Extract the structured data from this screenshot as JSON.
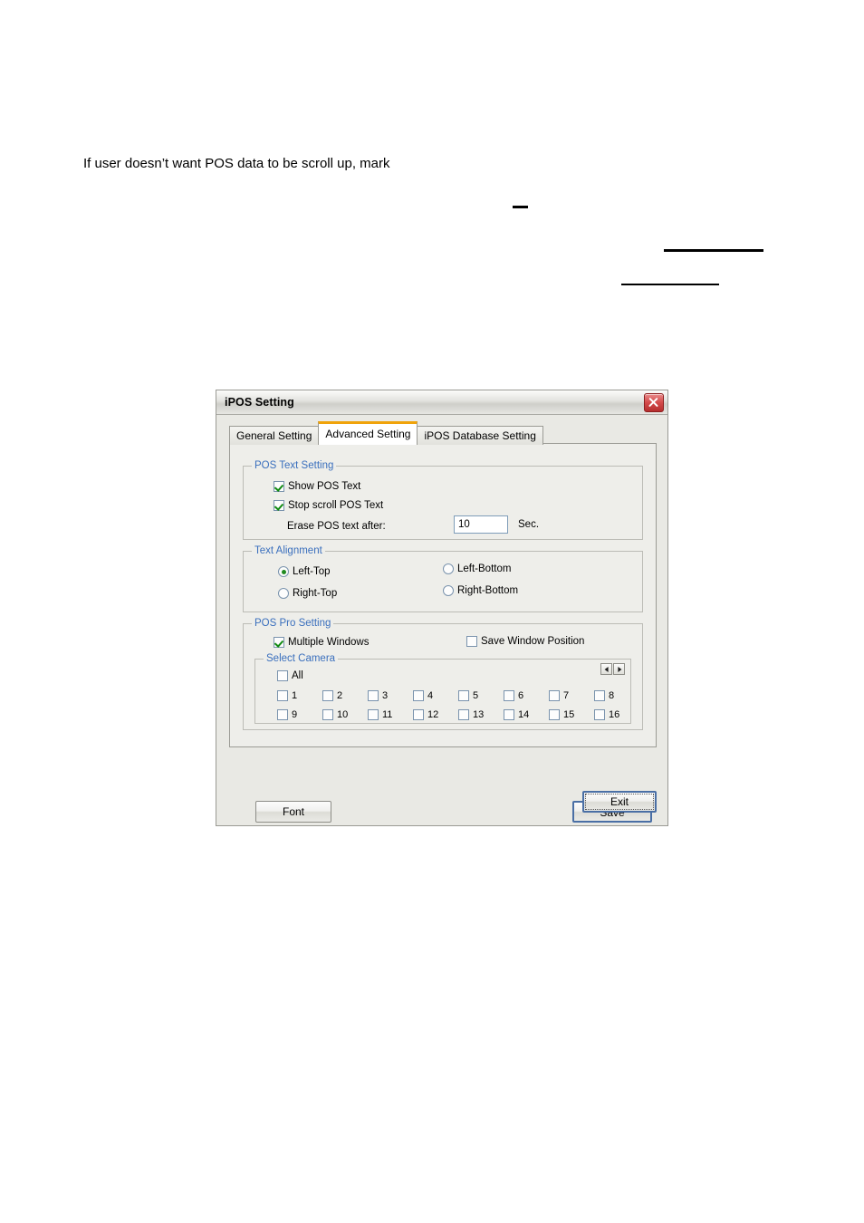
{
  "document": {
    "paragraph": "If user doesn’t want POS data to be scroll up, mark",
    "dash_mark": "",
    "rule_1": "",
    "rule_2": ""
  },
  "dialog": {
    "title": "iPOS Setting",
    "close_icon": "close-icon",
    "tabs": [
      {
        "label": "General Setting",
        "active": false
      },
      {
        "label": "Advanced Setting",
        "active": true
      },
      {
        "label": "iPOS Database Setting",
        "active": false
      }
    ],
    "pos_text_setting": {
      "title": "POS Text Setting",
      "show_pos_text": {
        "label": "Show POS Text",
        "checked": true
      },
      "stop_scroll_pos_text": {
        "label": "Stop scroll POS Text",
        "checked": true
      },
      "erase_label": "Erase POS text after:",
      "erase_value": "10",
      "erase_unit": "Sec."
    },
    "text_alignment": {
      "title": "Text Alignment",
      "options": [
        {
          "label": "Left-Top",
          "selected": true
        },
        {
          "label": "Right-Top",
          "selected": false
        },
        {
          "label": "Left-Bottom",
          "selected": false
        },
        {
          "label": "Right-Bottom",
          "selected": false
        }
      ]
    },
    "pos_pro_setting": {
      "title": "POS Pro Setting",
      "multiple_windows": {
        "label": "Multiple Windows",
        "checked": true
      },
      "save_window_position": {
        "label": "Save Window Position",
        "checked": false
      },
      "select_camera": {
        "title": "Select Camera",
        "all": {
          "label": "All",
          "checked": false
        },
        "cameras": [
          {
            "label": "1",
            "checked": false
          },
          {
            "label": "2",
            "checked": false
          },
          {
            "label": "3",
            "checked": false
          },
          {
            "label": "4",
            "checked": false
          },
          {
            "label": "5",
            "checked": false
          },
          {
            "label": "6",
            "checked": false
          },
          {
            "label": "7",
            "checked": false
          },
          {
            "label": "8",
            "checked": false
          },
          {
            "label": "9",
            "checked": false
          },
          {
            "label": "10",
            "checked": false
          },
          {
            "label": "11",
            "checked": false
          },
          {
            "label": "12",
            "checked": false
          },
          {
            "label": "13",
            "checked": false
          },
          {
            "label": "14",
            "checked": false
          },
          {
            "label": "15",
            "checked": false
          },
          {
            "label": "16",
            "checked": false
          }
        ],
        "prev_icon": "arrow-left-icon",
        "next_icon": "arrow-right-icon"
      }
    },
    "buttons": {
      "font": "Font",
      "save": "Save",
      "exit": "Exit"
    }
  },
  "colors": {
    "accent_tab": "#f0a30a",
    "group_title": "#3a6fbd",
    "check_green": "#108a10",
    "close_red": "#d44b4b",
    "focus_blue": "#4a6fa5"
  }
}
